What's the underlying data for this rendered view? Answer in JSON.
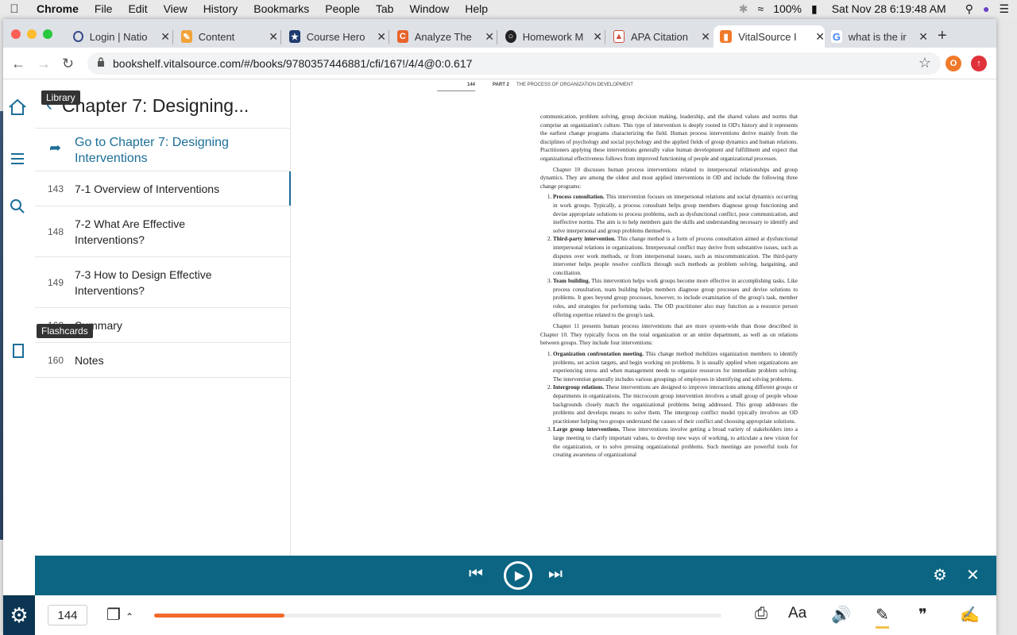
{
  "menubar": {
    "app_name": "Chrome",
    "items": [
      "File",
      "Edit",
      "View",
      "History",
      "Bookmarks",
      "People",
      "Tab",
      "Window",
      "Help"
    ],
    "battery": "100%",
    "datetime": "Sat Nov 28  6:19:48 AM"
  },
  "tabs": [
    {
      "title": "Login | Natio",
      "color": "#3b4b8c"
    },
    {
      "title": "Content",
      "color": "#f1a33a"
    },
    {
      "title": "Course Hero",
      "color": "#1f3a6e"
    },
    {
      "title": "Analyze The",
      "color": "#e8632b"
    },
    {
      "title": "Homework M",
      "color": "#222222"
    },
    {
      "title": "APA Citation",
      "color": "#d04e3b"
    },
    {
      "title": "VitalSource I",
      "color": "#f07a2a"
    },
    {
      "title": "what is the ir",
      "color": "#4285f4"
    }
  ],
  "active_tab_index": 6,
  "address_bar": {
    "url": "bookshelf.vitalsource.com/#/books/9780357446881/cfi/167!/4/4@0:0.617"
  },
  "extensions": {
    "o_badge": "O"
  },
  "sidebar": {
    "back_title": "Chapter 7: Designing...",
    "go_to_label": "Go to Chapter 7: Designing Interventions",
    "items": [
      {
        "page": "143",
        "label": "7-1 Overview of Interventions"
      },
      {
        "page": "148",
        "label": "7-2 What Are Effective Interventions?"
      },
      {
        "page": "149",
        "label": "7-3 How to Design Effective Interventions?"
      },
      {
        "page": "160",
        "label": "Summary"
      },
      {
        "page": "160",
        "label": "Notes"
      }
    ]
  },
  "tooltips": {
    "library": "Library",
    "flashcards": "Flashcards"
  },
  "book_page": {
    "page_number": "144",
    "part_label": "PART 2",
    "part_title": "THE PROCESS OF ORGANIZATION DEVELOPMENT",
    "para1": "communication, problem solving, group decision making, leadership, and the shared values and norms that comprise an organization's culture. This type of intervention is deeply rooted in OD's history and it represents the earliest change programs characterizing the field. Human process interventions derive mainly from the disciplines of psychology and social psychology and the applied fields of group dynamics and human relations. Practitioners applying these interventions generally value human development and fulfillment and expect that organizational effectiveness follows from improved functioning of people and organizational processes.",
    "para2": "Chapter 10 discusses human process interventions related to interpersonal relationships and group dynamics. They are among the oldest and most applied interventions in OD and include the following three change programs:",
    "list1": [
      {
        "term": "Process consultation.",
        "text": "This intervention focuses on interpersonal relations and social dynamics occurring in work groups. Typically, a process consultant helps group members diagnose group functioning and devise appropriate solutions to process problems, such as dysfunctional conflict, poor communication, and ineffective norms. The aim is to help members gain the skills and understanding necessary to identify and solve interpersonal and group problems themselves."
      },
      {
        "term": "Third-party intervention.",
        "text": "This change method is a form of process consultation aimed at dysfunctional interpersonal relations in organizations. Interpersonal conflict may derive from substantive issues, such as disputes over work methods, or from interpersonal issues, such as miscommunication. The third-party intervener helps people resolve conflicts through such methods as problem solving, bargaining, and conciliation."
      },
      {
        "term": "Team building.",
        "text": "This intervention helps work groups become more effective in accomplishing tasks. Like process consultation, team building helps members diagnose group processes and devise solutions to problems. It goes beyond group processes, however, to include examination of the group's task, member roles, and strategies for performing tasks. The OD practitioner also may function as a resource person offering expertise related to the group's task."
      }
    ],
    "para3": "Chapter 11 presents human process interventions that are more system-wide than those described in Chapter 10. They typically focus on the total organization or an entire department, as well as on relations between groups. They include four interventions:",
    "list2": [
      {
        "term": "Organization confrontation meeting.",
        "text": "This change method mobilizes organization members to identify problems, set action targets, and begin working on problems. It is usually applied when organizations are experiencing stress and when management needs to organize resources for immediate problem solving. The intervention generally includes various groupings of employees in identifying and solving problems."
      },
      {
        "term": "Intergroup relations.",
        "text": "These interventions are designed to improve interactions among different groups or departments in organizations. The microcosm group intervention involves a small group of people whose backgrounds closely match the organizational problems being addressed. This group addresses the problems and develops means to solve them. The intergroup conflict model typically involves an OD practitioner helping two groups understand the causes of their conflict and choosing appropriate solutions."
      },
      {
        "term": "Large group interventions.",
        "text": "These interventions involve getting a broad variety of stakeholders into a large meeting to clarify important values, to develop new ways of working, to articulate a new vision for the organization, or to solve pressing organizational problems. Such meetings are powerful tools for creating awareness of organizational"
      }
    ]
  },
  "footer": {
    "page_input": "144",
    "reading_progress": 0.23
  }
}
